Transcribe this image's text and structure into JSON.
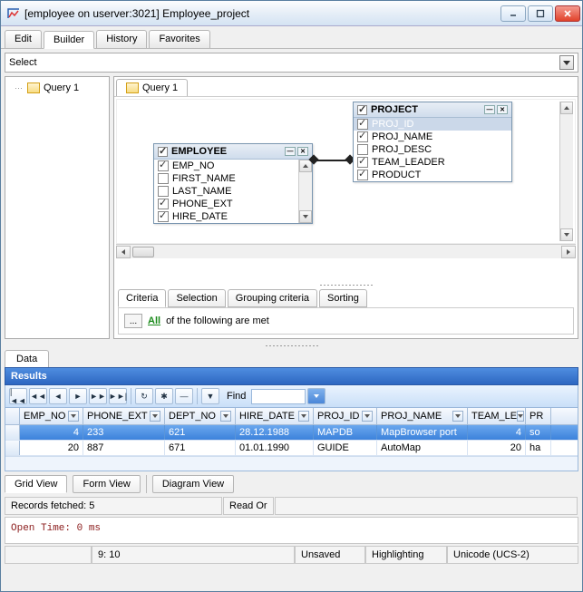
{
  "window": {
    "title": "[employee on userver:3021] Employee_project"
  },
  "topTabs": [
    "Edit",
    "Builder",
    "History",
    "Favorites"
  ],
  "activeTopTab": 1,
  "selectBar": {
    "label": "Select"
  },
  "queryTree": {
    "items": [
      "Query 1"
    ]
  },
  "designTabs": [
    "Query 1"
  ],
  "entities": {
    "employee": {
      "title": "EMPLOYEE",
      "headerChecked": true,
      "fields": [
        {
          "name": "EMP_NO",
          "checked": true
        },
        {
          "name": "FIRST_NAME",
          "checked": false
        },
        {
          "name": "LAST_NAME",
          "checked": false
        },
        {
          "name": "PHONE_EXT",
          "checked": true
        },
        {
          "name": "HIRE_DATE",
          "checked": true
        }
      ]
    },
    "project": {
      "title": "PROJECT",
      "headerChecked": true,
      "fields": [
        {
          "name": "PROJ_ID",
          "checked": true,
          "selected": true
        },
        {
          "name": "PROJ_NAME",
          "checked": true
        },
        {
          "name": "PROJ_DESC",
          "checked": false
        },
        {
          "name": "TEAM_LEADER",
          "checked": true
        },
        {
          "name": "PRODUCT",
          "checked": true
        }
      ]
    }
  },
  "criteriaTabs": [
    "Criteria",
    "Selection",
    "Grouping criteria",
    "Sorting"
  ],
  "criteriaRow": {
    "all": "All",
    "rest": "of the following are met",
    "btn": "..."
  },
  "dataTab": "Data",
  "resultsLabel": "Results",
  "findLabel": "Find",
  "grid": {
    "columns": [
      "EMP_NO",
      "PHONE_EXT",
      "DEPT_NO",
      "HIRE_DATE",
      "PROJ_ID",
      "PROJ_NAME",
      "TEAM_LE",
      "PR"
    ],
    "rows": [
      {
        "cells": [
          "4",
          "233",
          "621",
          "28.12.1988",
          "MAPDB",
          "MapBrowser port",
          "4",
          "so"
        ],
        "selected": true
      },
      {
        "cells": [
          "20",
          "887",
          "671",
          "01.01.1990",
          "GUIDE",
          "AutoMap",
          "20",
          "ha"
        ],
        "selected": false
      }
    ]
  },
  "viewTabs": [
    "Grid View",
    "Form View",
    "Diagram View"
  ],
  "statusStrip": {
    "records": "Records fetched: 5",
    "mode": "Read Or"
  },
  "console": "Open Time: 0 ms",
  "bottomStatus": {
    "pos": "9: 10",
    "state": "Unsaved",
    "hl": "Highlighting",
    "enc": "Unicode (UCS-2)"
  }
}
